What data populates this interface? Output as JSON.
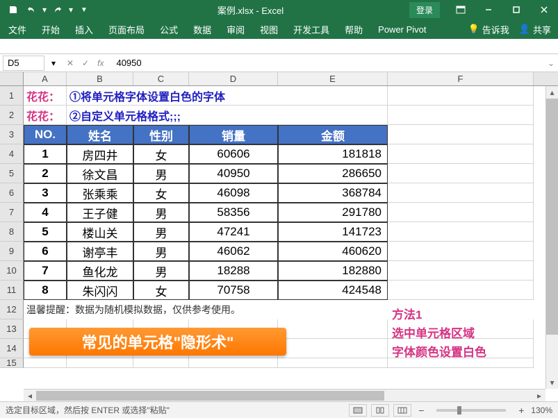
{
  "titlebar": {
    "title": "案例.xlsx - Excel",
    "login": "登录"
  },
  "ribbon": {
    "tabs": [
      "文件",
      "开始",
      "插入",
      "页面布局",
      "公式",
      "数据",
      "审阅",
      "视图",
      "开发工具",
      "帮助",
      "Power Pivot"
    ],
    "tell_me": "告诉我",
    "share": "共享"
  },
  "formula_bar": {
    "name_box": "D5",
    "formula": "40950"
  },
  "columns": [
    "A",
    "B",
    "C",
    "D",
    "E",
    "F"
  ],
  "row_numbers": [
    1,
    2,
    3,
    4,
    5,
    6,
    7,
    8,
    9,
    10,
    11,
    12,
    13,
    14,
    15
  ],
  "text_rows": {
    "r1_label": "花花：",
    "r1_text": "①将单元格字体设置白色的字体",
    "r2_label": "花花：",
    "r2_text": "②自定义单元格格式;;;"
  },
  "table": {
    "headers": [
      "NO.",
      "姓名",
      "性别",
      "销量",
      "金额"
    ],
    "rows": [
      {
        "no": "1",
        "name": "房四井",
        "sex": "女",
        "qty": "60606",
        "amt": "181818"
      },
      {
        "no": "2",
        "name": "徐文昌",
        "sex": "男",
        "qty": "40950",
        "amt": "286650"
      },
      {
        "no": "3",
        "name": "张乘乘",
        "sex": "女",
        "qty": "46098",
        "amt": "368784"
      },
      {
        "no": "4",
        "name": "王子健",
        "sex": "男",
        "qty": "58356",
        "amt": "291780"
      },
      {
        "no": "5",
        "name": "楼山关",
        "sex": "男",
        "qty": "47241",
        "amt": "141723"
      },
      {
        "no": "6",
        "name": "谢亭丰",
        "sex": "男",
        "qty": "46062",
        "amt": "460620"
      },
      {
        "no": "7",
        "name": "鱼化龙",
        "sex": "男",
        "qty": "18288",
        "amt": "182880"
      },
      {
        "no": "8",
        "name": "朱闪闪",
        "sex": "女",
        "qty": "70758",
        "amt": "424548"
      }
    ]
  },
  "footer_note": "温馨提醒：数据为随机模拟数据，仅供参考使用。",
  "banner": "常见的单元格\"隐形术\"",
  "method": {
    "l1": "方法1",
    "l2": "选中单元格区域",
    "l3": "字体颜色设置白色"
  },
  "status": {
    "text": "选定目标区域，然后按 ENTER 或选择\"粘贴\"",
    "zoom": "130%"
  }
}
